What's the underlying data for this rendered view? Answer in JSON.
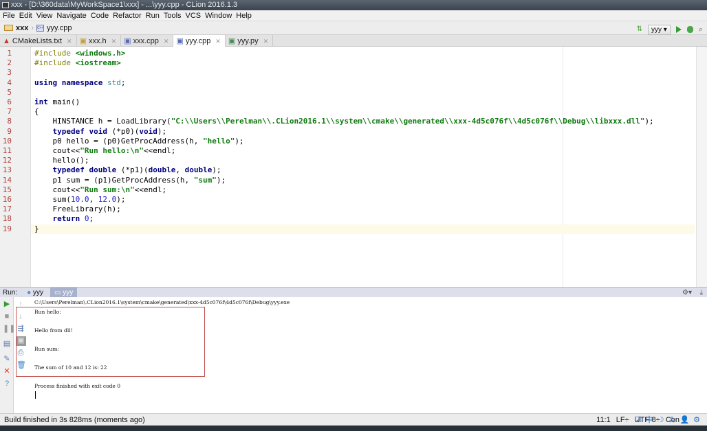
{
  "window": {
    "title": "xxx - [D:\\360data\\MyWorkSpace1\\xxx] - ...\\yyy.cpp - CLion 2016.1.3"
  },
  "menu": [
    "File",
    "Edit",
    "View",
    "Navigate",
    "Code",
    "Refactor",
    "Run",
    "Tools",
    "VCS",
    "Window",
    "Help"
  ],
  "breadcrumb": {
    "project": "xxx",
    "file": "yyy.cpp"
  },
  "run_config": {
    "selected": "yyy"
  },
  "tabs": [
    {
      "label": "CMakeLists.txt",
      "icon": "cmake-icon",
      "active": false
    },
    {
      "label": "xxx.h",
      "icon": "header-file-icon",
      "active": false
    },
    {
      "label": "xxx.cpp",
      "icon": "cpp-file-icon",
      "active": false
    },
    {
      "label": "yyy.cpp",
      "icon": "cpp-file-icon",
      "active": true
    },
    {
      "label": "yyy.py",
      "icon": "python-file-icon",
      "active": false
    }
  ],
  "editor": {
    "current_line": 19,
    "lines": [
      [
        [
          "pp",
          "#include "
        ],
        [
          "str",
          "<windows.h>"
        ]
      ],
      [
        [
          "pp",
          "#include "
        ],
        [
          "str",
          "<iostream>"
        ]
      ],
      [],
      [
        [
          "kw",
          "using namespace "
        ],
        [
          "ns",
          "std"
        ],
        [
          "plain",
          ";"
        ]
      ],
      [],
      [
        [
          "kw",
          "int "
        ],
        [
          "plain",
          "main()"
        ]
      ],
      [
        [
          "plain",
          "{"
        ]
      ],
      [
        [
          "plain",
          "    HINSTANCE h = LoadLibrary("
        ],
        [
          "str",
          "\"C:\\\\Users\\\\Perelman\\\\.CLion2016.1\\\\system\\\\cmake\\\\generated\\\\xxx-4d5c076f\\\\4d5c076f\\\\Debug\\\\libxxx.dll\""
        ],
        [
          "plain",
          ");"
        ]
      ],
      [
        [
          "plain",
          "    "
        ],
        [
          "kw",
          "typedef void "
        ],
        [
          "plain",
          "(*p0)("
        ],
        [
          "kw",
          "void"
        ],
        [
          "plain",
          ");"
        ]
      ],
      [
        [
          "plain",
          "    p0 hello = (p0)GetProcAddress(h, "
        ],
        [
          "str",
          "\"hello\""
        ],
        [
          "plain",
          ");"
        ]
      ],
      [
        [
          "plain",
          "    cout<<"
        ],
        [
          "str",
          "\"Run hello:\\n\""
        ],
        [
          "plain",
          "<<endl;"
        ]
      ],
      [
        [
          "plain",
          "    hello();"
        ]
      ],
      [
        [
          "plain",
          "    "
        ],
        [
          "kw",
          "typedef double "
        ],
        [
          "plain",
          "(*p1)("
        ],
        [
          "kw",
          "double"
        ],
        [
          "plain",
          ", "
        ],
        [
          "kw",
          "double"
        ],
        [
          "plain",
          ");"
        ]
      ],
      [
        [
          "plain",
          "    p1 sum = (p1)GetProcAddress(h, "
        ],
        [
          "str",
          "\"sum\""
        ],
        [
          "plain",
          ");"
        ]
      ],
      [
        [
          "plain",
          "    cout<<"
        ],
        [
          "str",
          "\"Run sum:\\n\""
        ],
        [
          "plain",
          "<<endl;"
        ]
      ],
      [
        [
          "plain",
          "    sum("
        ],
        [
          "num",
          "10.0"
        ],
        [
          "plain",
          ", "
        ],
        [
          "num",
          "12.0"
        ],
        [
          "plain",
          ");"
        ]
      ],
      [
        [
          "plain",
          "    FreeLibrary(h);"
        ]
      ],
      [
        [
          "plain",
          "    "
        ],
        [
          "kw",
          "return "
        ],
        [
          "num",
          "0"
        ],
        [
          "plain",
          ";"
        ]
      ],
      [
        [
          "plain",
          "}"
        ]
      ]
    ]
  },
  "run": {
    "label": "Run:",
    "tabs": [
      {
        "label": "yyy",
        "active": false
      },
      {
        "label": "yyy",
        "active": true
      }
    ],
    "output": [
      "C:\\Users\\Perelman\\.CLion2016.1\\system\\cmake\\generated\\xxx-4d5c076f\\4d5c076f\\Debug\\yyy.exe",
      "Run hello:",
      "",
      "Hello from dll!",
      "",
      "Run sum:",
      "",
      "The sum of 10 and 12 is: 22",
      "",
      "Process finished with exit code 0"
    ]
  },
  "status": {
    "message": "Build finished in 3s 828ms (moments ago)",
    "position": "11:1",
    "line_sep": "LF÷",
    "encoding": "UTF-8÷",
    "context": "Con"
  },
  "colors": {
    "keyword": "#000080",
    "string": "#107a10",
    "number": "#1c1cd0",
    "highlight_box": "#c0504d"
  }
}
